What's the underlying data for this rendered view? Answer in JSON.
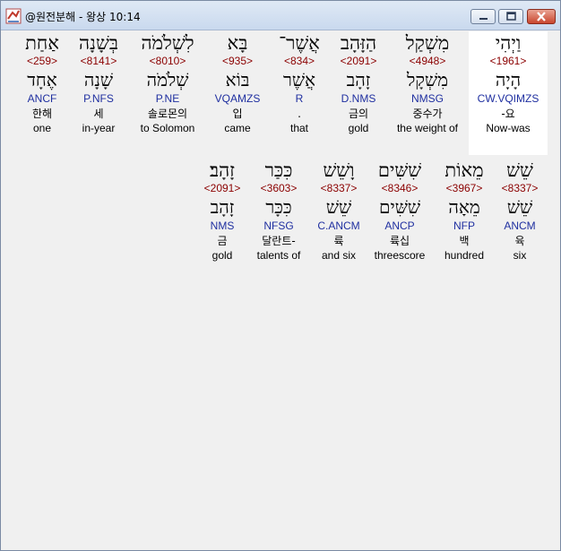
{
  "window": {
    "title": "@원전분해 - 왕상 10:14"
  },
  "verse_rows": [
    {
      "words": [
        {
          "hebrew": "אַחַת",
          "strong": "<259>",
          "lemma": "אֶחָד",
          "morph": "ANCF",
          "korean": "한해",
          "english": "one"
        },
        {
          "hebrew": "בְּשָׁנָה",
          "strong": "<8141>",
          "lemma": "שָׁנָה",
          "morph": "P.NFS",
          "korean": "세",
          "english": "in-year"
        },
        {
          "hebrew": "לִשְׁלֹמֹה",
          "strong": "<8010>",
          "lemma": "שְׁלֹמֹה",
          "morph": "P.NE",
          "korean": "솔로몬의",
          "english": "to Solomon"
        },
        {
          "hebrew": "בָּא",
          "strong": "<935>",
          "lemma": "בּוֹא",
          "morph": "VQAMZS",
          "korean": "입",
          "english": "came"
        },
        {
          "hebrew": "אֲשֶׁר־",
          "strong": "<834>",
          "lemma": "אֲשֶׁר",
          "morph": "R",
          "korean": ".",
          "english": "that"
        },
        {
          "hebrew": "הַזָּהָב",
          "strong": "<2091>",
          "lemma": "זָהָב",
          "morph": "D.NMS",
          "korean": "금의",
          "english": "gold"
        },
        {
          "hebrew": "מִשְׁקַל",
          "strong": "<4948>",
          "lemma": "מִשְׁקָל",
          "morph": "NMSG",
          "korean": "중수가",
          "english": "the weight of"
        },
        {
          "hebrew": "וַיְהִי",
          "strong": "<1961>",
          "lemma": "הָיָה",
          "morph": "CW.VQIMZS",
          "korean": "-요",
          "english": "Now-was",
          "selected": true
        }
      ]
    },
    {
      "words": [
        {
          "hebrew": "זָהָב׃",
          "strong": "<2091>",
          "lemma": "זָהָב",
          "morph": "NMS",
          "korean": "금",
          "english": "gold"
        },
        {
          "hebrew": "כִּכַּר",
          "strong": "<3603>",
          "lemma": "כִּכָּר",
          "morph": "NFSG",
          "korean": "달란트-",
          "english": "talents of"
        },
        {
          "hebrew": "וָשֵׁשׁ",
          "strong": "<8337>",
          "lemma": "שֵׁשׁ",
          "morph": "C.ANCM",
          "korean": "륙",
          "english": "and six"
        },
        {
          "hebrew": "שִׁשִּׁים",
          "strong": "<8346>",
          "lemma": "שִׁשִּׁים",
          "morph": "ANCP",
          "korean": "륙십",
          "english": "threescore"
        },
        {
          "hebrew": "מֵאוֹת",
          "strong": "<3967>",
          "lemma": "מֵאָה",
          "morph": "NFP",
          "korean": "백",
          "english": "hundred"
        },
        {
          "hebrew": "שֵׁשׁ",
          "strong": "<8337>",
          "lemma": "שֵׁשׁ",
          "morph": "ANCM",
          "korean": "육",
          "english": "six"
        }
      ]
    }
  ]
}
